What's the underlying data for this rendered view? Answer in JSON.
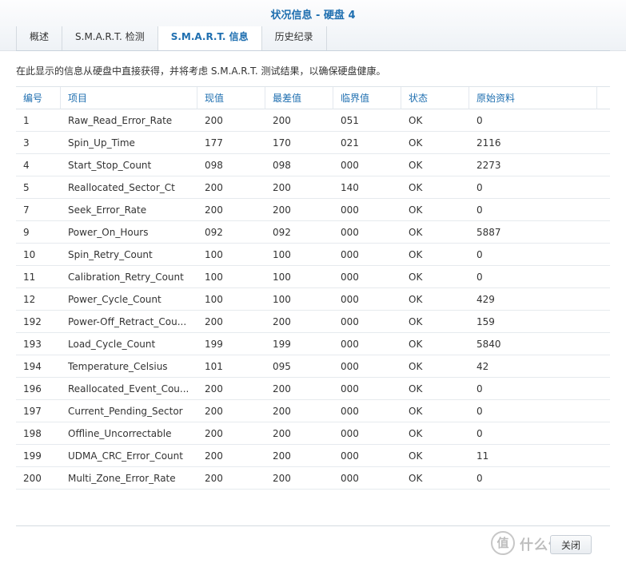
{
  "dialog": {
    "title": "状况信息 - 硬盘 4"
  },
  "tabs": [
    {
      "label": "概述",
      "active": false
    },
    {
      "label": "S.M.A.R.T. 检测",
      "active": false
    },
    {
      "label": "S.M.A.R.T. 信息",
      "active": true
    },
    {
      "label": "历史纪录",
      "active": false
    }
  ],
  "description": "在此显示的信息从硬盘中直接获得，并将考虑 S.M.A.R.T. 测试结果，以确保硬盘健康。",
  "table": {
    "columns": [
      "编号",
      "项目",
      "现值",
      "最差值",
      "临界值",
      "状态",
      "原始资料"
    ],
    "rows": [
      [
        "1",
        "Raw_Read_Error_Rate",
        "200",
        "200",
        "051",
        "OK",
        "0"
      ],
      [
        "3",
        "Spin_Up_Time",
        "177",
        "170",
        "021",
        "OK",
        "2116"
      ],
      [
        "4",
        "Start_Stop_Count",
        "098",
        "098",
        "000",
        "OK",
        "2273"
      ],
      [
        "5",
        "Reallocated_Sector_Ct",
        "200",
        "200",
        "140",
        "OK",
        "0"
      ],
      [
        "7",
        "Seek_Error_Rate",
        "200",
        "200",
        "000",
        "OK",
        "0"
      ],
      [
        "9",
        "Power_On_Hours",
        "092",
        "092",
        "000",
        "OK",
        "5887"
      ],
      [
        "10",
        "Spin_Retry_Count",
        "100",
        "100",
        "000",
        "OK",
        "0"
      ],
      [
        "11",
        "Calibration_Retry_Count",
        "100",
        "100",
        "000",
        "OK",
        "0"
      ],
      [
        "12",
        "Power_Cycle_Count",
        "100",
        "100",
        "000",
        "OK",
        "429"
      ],
      [
        "192",
        "Power-Off_Retract_Cou...",
        "200",
        "200",
        "000",
        "OK",
        "159"
      ],
      [
        "193",
        "Load_Cycle_Count",
        "199",
        "199",
        "000",
        "OK",
        "5840"
      ],
      [
        "194",
        "Temperature_Celsius",
        "101",
        "095",
        "000",
        "OK",
        "42"
      ],
      [
        "196",
        "Reallocated_Event_Cou...",
        "200",
        "200",
        "000",
        "OK",
        "0"
      ],
      [
        "197",
        "Current_Pending_Sector",
        "200",
        "200",
        "000",
        "OK",
        "0"
      ],
      [
        "198",
        "Offline_Uncorrectable",
        "200",
        "200",
        "000",
        "OK",
        "0"
      ],
      [
        "199",
        "UDMA_CRC_Error_Count",
        "200",
        "200",
        "000",
        "OK",
        "11"
      ],
      [
        "200",
        "Multi_Zone_Error_Rate",
        "200",
        "200",
        "000",
        "OK",
        "0"
      ]
    ]
  },
  "footer": {
    "close_label": "关闭"
  },
  "watermark": {
    "logo_char": "值",
    "text": "什么值得买"
  },
  "colors": {
    "accent": "#1f6fb0",
    "border": "#dde3e9"
  }
}
